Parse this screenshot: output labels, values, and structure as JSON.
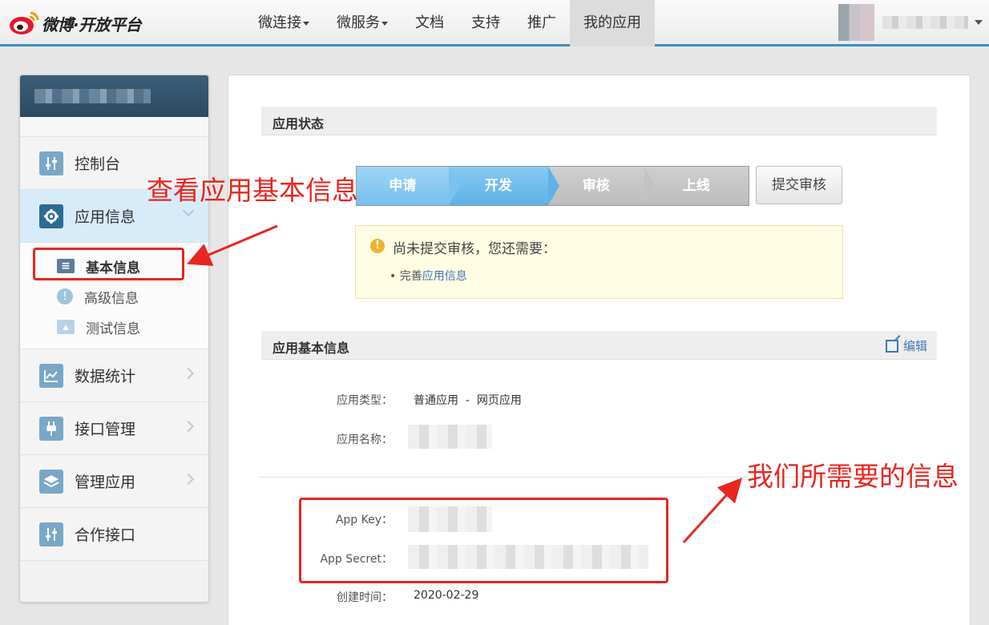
{
  "header": {
    "logo_text": "微博·开放平台",
    "nav": [
      {
        "label": "微连接",
        "dropdown": true
      },
      {
        "label": "微服务",
        "dropdown": true
      },
      {
        "label": "文档",
        "dropdown": false
      },
      {
        "label": "支持",
        "dropdown": false
      },
      {
        "label": "推广",
        "dropdown": false
      },
      {
        "label": "我的应用",
        "dropdown": false,
        "active": true
      }
    ]
  },
  "sidebar": {
    "items": [
      {
        "label": "控制台",
        "icon": "sliders-icon"
      },
      {
        "label": "应用信息",
        "icon": "gear-icon"
      },
      {
        "label": "数据统计",
        "icon": "chart-icon"
      },
      {
        "label": "接口管理",
        "icon": "plug-icon"
      },
      {
        "label": "管理应用",
        "icon": "layers-icon"
      },
      {
        "label": "合作接口",
        "icon": "sliders-icon"
      }
    ],
    "sub_items": [
      {
        "label": "基本信息",
        "icon": "id-card-icon"
      },
      {
        "label": "高级信息",
        "icon": "info-icon"
      },
      {
        "label": "测试信息",
        "icon": "test-card-icon"
      }
    ]
  },
  "main": {
    "status_title": "应用状态",
    "steps": [
      "申请",
      "开发",
      "审核",
      "上线"
    ],
    "submit_label": "提交审核",
    "notice": {
      "message": "尚未提交审核，您还需要：",
      "todo_prefix": "完善",
      "todo_link": "应用信息"
    },
    "basic_title": "应用基本信息",
    "edit_label": "编辑",
    "fields": {
      "type_label": "应用类型：",
      "type_value": "普通应用  -  网页应用",
      "name_label": "应用名称：",
      "key_label": "App Key：",
      "secret_label": "App Secret：",
      "created_label": "创建时间：",
      "created_value": "2020-02-29"
    }
  },
  "annotations": {
    "view_basic": "查看应用基本信息",
    "needed_info": "我们所需要的信息"
  },
  "colors": {
    "accent_blue": "#3f8fc4",
    "step_active": "#78c0ee",
    "annotation_red": "#e8261f"
  }
}
